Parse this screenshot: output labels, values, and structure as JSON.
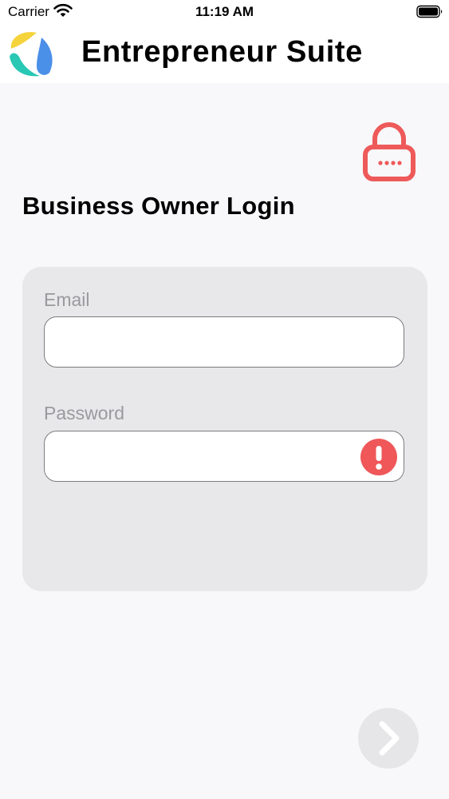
{
  "status_bar": {
    "carrier": "Carrier",
    "time": "11:19 AM"
  },
  "header": {
    "app_title": "Entrepreneur Suite",
    "logo_colors": [
      "#f5d33b",
      "#4a8fe8",
      "#28c8b4"
    ]
  },
  "page": {
    "title": "Business Owner Login",
    "lock_icon": "lock-icon",
    "lock_color": "#ee5a5a"
  },
  "form": {
    "email": {
      "label": "Email",
      "value": "",
      "placeholder": ""
    },
    "password": {
      "label": "Password",
      "value": "",
      "placeholder": "",
      "error_icon": "exclamation-circle-icon",
      "error_color": "#ef5759"
    }
  },
  "next_button": {
    "icon": "chevron-right-icon"
  },
  "colors": {
    "background": "#f8f8fa",
    "card": "#e8e8ea",
    "label": "#9a9a9e",
    "accent_red": "#ee5a5a"
  }
}
